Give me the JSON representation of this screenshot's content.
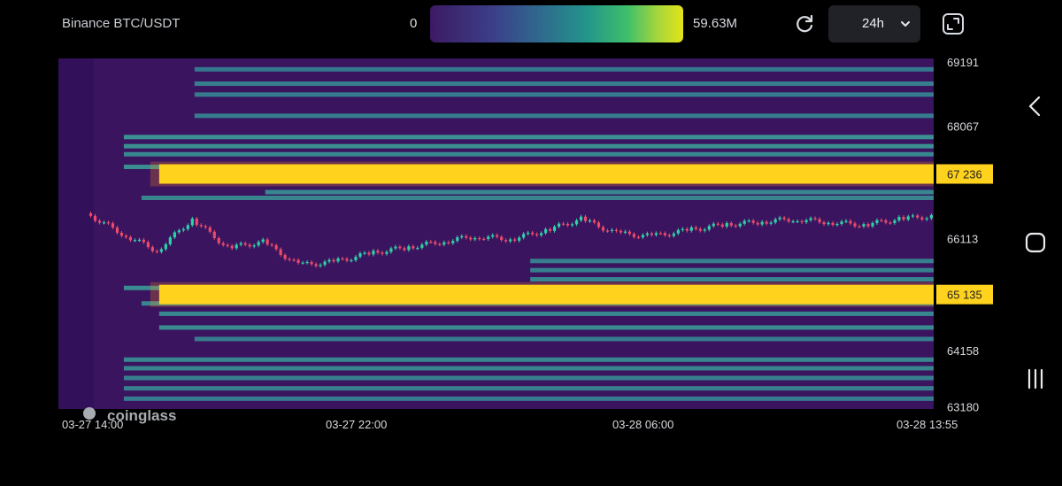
{
  "header": {
    "pair": "Binance BTC/USDT",
    "colorbar_min": "0",
    "colorbar_max": "59.63M",
    "colorbar_colors": [
      "#3d1a63",
      "#3b3f89",
      "#2e6d8e",
      "#23958a",
      "#3fbf6b",
      "#a6d63b",
      "#e4e418"
    ],
    "range_label": "24h",
    "refresh_icon": "refresh-icon",
    "fullscreen_icon": "fullscreen-icon"
  },
  "watermark": "coinglass",
  "chart_data": {
    "type": "heatmap",
    "title": "",
    "xlabel": "",
    "ylabel": "",
    "x_tick_labels": [
      "03-27 14:00",
      "03-27 22:00",
      "03-28 06:00",
      "03-28 13:55"
    ],
    "x_range": [
      "2024-03-27 14:00",
      "2024-03-28 13:55"
    ],
    "y_ticks": [
      69191,
      68067,
      67236,
      66113,
      65135,
      64158,
      63180
    ],
    "y_tick_labels": [
      "69191",
      "68067",
      "67 236",
      "66113",
      "65 135",
      "64158",
      "63180"
    ],
    "highlighted_levels": [
      {
        "price": 67236,
        "label": "67 236",
        "start": "2024-03-27 16:00",
        "end": "2024-03-28 13:55",
        "intensity": 1.0
      },
      {
        "price": 65135,
        "label": "65 135",
        "start": "2024-03-27 16:00",
        "end": "2024-03-28 13:55",
        "intensity": 1.0
      }
    ],
    "liquidity_bands": [
      {
        "price": 69060,
        "start": "2024-03-27 17:00",
        "end": "2024-03-28 13:55",
        "intensity": 0.25
      },
      {
        "price": 68810,
        "start": "2024-03-27 17:00",
        "end": "2024-03-28 13:55",
        "intensity": 0.35
      },
      {
        "price": 68620,
        "start": "2024-03-27 17:00",
        "end": "2024-03-28 13:55",
        "intensity": 0.3
      },
      {
        "price": 68250,
        "start": "2024-03-27 17:00",
        "end": "2024-03-28 13:55",
        "intensity": 0.3
      },
      {
        "price": 67880,
        "start": "2024-03-27 15:00",
        "end": "2024-03-28 13:55",
        "intensity": 0.55
      },
      {
        "price": 67720,
        "start": "2024-03-27 15:00",
        "end": "2024-03-28 13:55",
        "intensity": 0.55
      },
      {
        "price": 67580,
        "start": "2024-03-27 15:00",
        "end": "2024-03-28 13:55",
        "intensity": 0.45
      },
      {
        "price": 67360,
        "start": "2024-03-27 15:00",
        "end": "2024-03-28 13:55",
        "intensity": 0.5
      },
      {
        "price": 66920,
        "start": "2024-03-27 19:00",
        "end": "2024-03-28 13:55",
        "intensity": 0.45
      },
      {
        "price": 66820,
        "start": "2024-03-27 15:30",
        "end": "2024-03-28 13:55",
        "intensity": 0.4
      },
      {
        "price": 65720,
        "start": "2024-03-28 02:30",
        "end": "2024-03-28 13:55",
        "intensity": 0.35
      },
      {
        "price": 65560,
        "start": "2024-03-28 02:30",
        "end": "2024-03-28 13:55",
        "intensity": 0.35
      },
      {
        "price": 65400,
        "start": "2024-03-28 02:30",
        "end": "2024-03-28 13:55",
        "intensity": 0.4
      },
      {
        "price": 65250,
        "start": "2024-03-27 15:00",
        "end": "2024-03-28 13:55",
        "intensity": 0.5
      },
      {
        "price": 64980,
        "start": "2024-03-27 15:30",
        "end": "2024-03-28 13:55",
        "intensity": 0.45
      },
      {
        "price": 64800,
        "start": "2024-03-27 16:00",
        "end": "2024-03-28 13:55",
        "intensity": 0.45
      },
      {
        "price": 64560,
        "start": "2024-03-27 16:00",
        "end": "2024-03-28 13:55",
        "intensity": 0.5
      },
      {
        "price": 64360,
        "start": "2024-03-27 17:00",
        "end": "2024-03-28 13:55",
        "intensity": 0.3
      },
      {
        "price": 64000,
        "start": "2024-03-27 15:00",
        "end": "2024-03-28 13:55",
        "intensity": 0.45
      },
      {
        "price": 63850,
        "start": "2024-03-27 15:00",
        "end": "2024-03-28 13:55",
        "intensity": 0.4
      },
      {
        "price": 63680,
        "start": "2024-03-27 15:00",
        "end": "2024-03-28 13:55",
        "intensity": 0.35
      },
      {
        "price": 63500,
        "start": "2024-03-27 15:00",
        "end": "2024-03-28 13:55",
        "intensity": 0.35
      },
      {
        "price": 63320,
        "start": "2024-03-27 15:00",
        "end": "2024-03-28 13:55",
        "intensity": 0.3
      }
    ],
    "price_series": {
      "name": "",
      "x": [
        "2024-03-27 14:00",
        "2024-03-27 15:00",
        "2024-03-27 16:00",
        "2024-03-27 17:00",
        "2024-03-27 18:00",
        "2024-03-27 19:00",
        "2024-03-27 20:00",
        "2024-03-27 21:00",
        "2024-03-27 22:00",
        "2024-03-27 23:00",
        "2024-03-28 00:00",
        "2024-03-28 01:00",
        "2024-03-28 02:00",
        "2024-03-28 03:00",
        "2024-03-28 04:00",
        "2024-03-28 05:00",
        "2024-03-28 06:00",
        "2024-03-28 07:00",
        "2024-03-28 08:00",
        "2024-03-28 09:00",
        "2024-03-28 10:00",
        "2024-03-28 11:00",
        "2024-03-28 12:00",
        "2024-03-28 13:00",
        "2024-03-28 13:55"
      ],
      "y": [
        66550,
        66200,
        65900,
        66450,
        65950,
        66050,
        65650,
        65700,
        65850,
        65950,
        66050,
        66150,
        66100,
        66250,
        66450,
        66200,
        66150,
        66250,
        66350,
        66400,
        66450,
        66400,
        66350,
        66450,
        66500
      ]
    },
    "colors": {
      "background": "#3a145f",
      "band_low": "#2e6d8e",
      "band_high": "#47c4a0",
      "highlight": "#ffd21e",
      "candle_up": "#2fd1a8",
      "candle_down": "#ea4b6a"
    },
    "grid": false,
    "legend": "colorbar-top"
  },
  "sysnav": {
    "back_icon": "back-icon",
    "home_icon": "home-icon",
    "recents_icon": "recents-icon"
  }
}
